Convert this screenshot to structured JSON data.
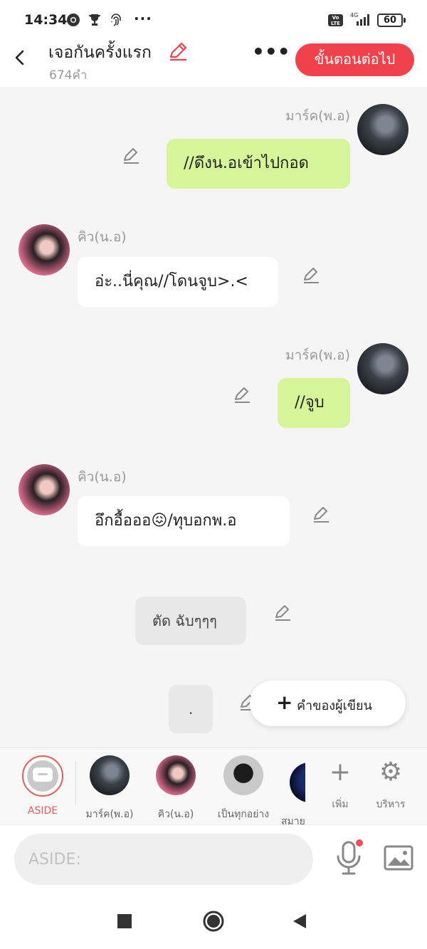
{
  "status_bar": {
    "time": "14:34",
    "more_dots": "···",
    "volte_label": "Vo LTE",
    "battery": "60"
  },
  "header": {
    "title": "เจอกันครั้งแรก",
    "word_count": "674คำ",
    "more_label": "•••",
    "next_button": "ขั้นตอนต่อไป"
  },
  "messages": [
    {
      "sender": "มาร์ค(พ.อ)",
      "text": "//ดึงน.อเข้าไปกอด"
    },
    {
      "sender": "คิว(น.อ)",
      "text": "อ่ะ..นี่คุณ//โดนจูบ>.<"
    },
    {
      "sender": "มาร์ค(พ.อ)",
      "text": "//จูบ"
    },
    {
      "sender": "คิว(น.อ)",
      "text": "อึกอื้อออ😖/ทุบอกพ.อ"
    },
    {
      "text": "ตัด ฉับๆๆๆ"
    },
    {
      "text": "."
    }
  ],
  "author_button": {
    "plus": "+",
    "label": "คำของผู้เขียน"
  },
  "selector": {
    "aside_label": "ASIDE",
    "characters": [
      "มาร์ค(พ.อ)",
      "คิว(น.อ)",
      "เป็นทุกอย่าง",
      "สมาย"
    ],
    "add_label": "เพิ่ม",
    "add_glyph": "+",
    "manage_label": "บริหาร",
    "manage_glyph": "⚙"
  },
  "input": {
    "placeholder": "ASIDE:"
  },
  "colors": {
    "accent": "#f1424b",
    "own_bubble": "#d6f59a",
    "other_bubble": "#ffffff",
    "background": "#f5f5f5"
  },
  "icons": [
    "chrome-icon",
    "trophy-icon",
    "fingerprint-icon",
    "back-icon",
    "edit-icon",
    "pencil-icon",
    "microphone-icon",
    "image-icon",
    "settings-icon",
    "plus-icon",
    "stop-icon",
    "home-icon",
    "back-triangle-icon"
  ]
}
